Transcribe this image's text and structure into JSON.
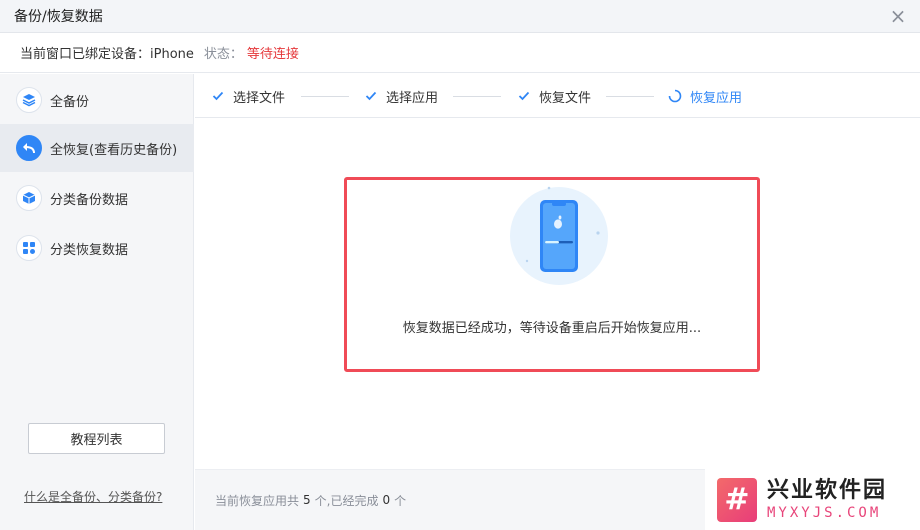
{
  "window": {
    "title": "备份/恢复数据",
    "close_glyph": "×"
  },
  "device": {
    "label": "当前窗口已绑定设备：iPhone",
    "status_label": "状态：",
    "status_value": "等待连接",
    "status_color": "#e5383b"
  },
  "sidebar": {
    "items": [
      {
        "label": "全备份",
        "icon": "layers-icon",
        "active": false
      },
      {
        "label": "全恢复(查看历史备份)",
        "icon": "undo-arrow-icon",
        "active": true
      },
      {
        "label": "分类备份数据",
        "icon": "cube-icon",
        "active": false
      },
      {
        "label": "分类恢复数据",
        "icon": "grid-icon",
        "active": false
      }
    ],
    "tutorial_button": "教程列表",
    "help_link": "什么是全备份、分类备份?"
  },
  "steps": [
    {
      "label": "选择文件",
      "state": "done"
    },
    {
      "label": "选择应用",
      "state": "done"
    },
    {
      "label": "恢复文件",
      "state": "done"
    },
    {
      "label": "恢复应用",
      "state": "current"
    }
  ],
  "content": {
    "message": "恢复数据已经成功，等待设备重启后开始恢复应用..."
  },
  "footer": {
    "prefix": "当前恢复应用共",
    "total": "5",
    "middle": "个,已经完成",
    "done": "0",
    "suffix": "个"
  },
  "watermark": {
    "logo_glyph": "#",
    "name": "兴业软件园",
    "url": "MYXYJS.COM"
  },
  "colors": {
    "accent": "#2f86f6",
    "highlight_border": "#f04b57"
  }
}
